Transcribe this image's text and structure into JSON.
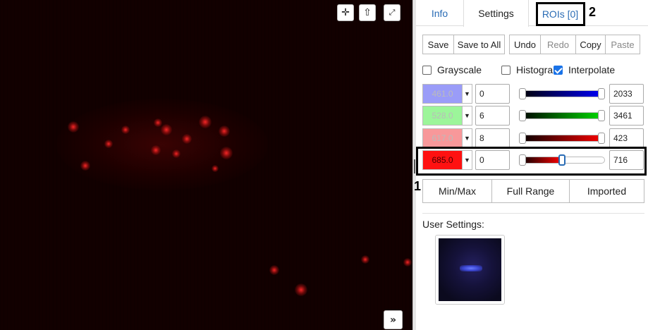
{
  "viewer": {
    "buttons": {
      "crosshair_icon": "✛",
      "home_icon": "⇧",
      "fullscreen_icon": "⤢",
      "collapse_icon": "»"
    }
  },
  "tabs": [
    {
      "label": "Info"
    },
    {
      "label": "Settings"
    },
    {
      "label": "ROIs [0]"
    }
  ],
  "toolbar": {
    "save": "Save",
    "save_all": "Save to All",
    "undo": "Undo",
    "redo": "Redo",
    "copy": "Copy",
    "paste": "Paste"
  },
  "options": {
    "grayscale": "Grayscale",
    "histogram": "Histogram",
    "interpolate": "Interpolate"
  },
  "channels": [
    {
      "wavelength": "461.0",
      "min": "0",
      "max": "2033",
      "color": "#9a9cf8",
      "track_color": "#0000ff",
      "start": 0.0,
      "end": 1.0
    },
    {
      "wavelength": "528.0",
      "min": "6",
      "max": "3461",
      "color": "#9cf59a",
      "track_color": "#00e000",
      "start": 0.0,
      "end": 1.0
    },
    {
      "wavelength": "617.0",
      "min": "8",
      "max": "423",
      "color": "#f8989a",
      "track_color": "#ff0000",
      "start": 0.0,
      "end": 1.0
    },
    {
      "wavelength": "685.0",
      "min": "0",
      "max": "716",
      "color": "#ff1111",
      "track_color": "#ff0000",
      "start": 0.0,
      "end": 0.5
    }
  ],
  "range_buttons": {
    "minmax": "Min/Max",
    "full": "Full Range",
    "imported": "Imported"
  },
  "user_settings_label": "User Settings:",
  "annotations": {
    "one": "1",
    "two": "2"
  },
  "colors": {
    "link": "#2a6cb5",
    "accent": "#1a73e8"
  }
}
